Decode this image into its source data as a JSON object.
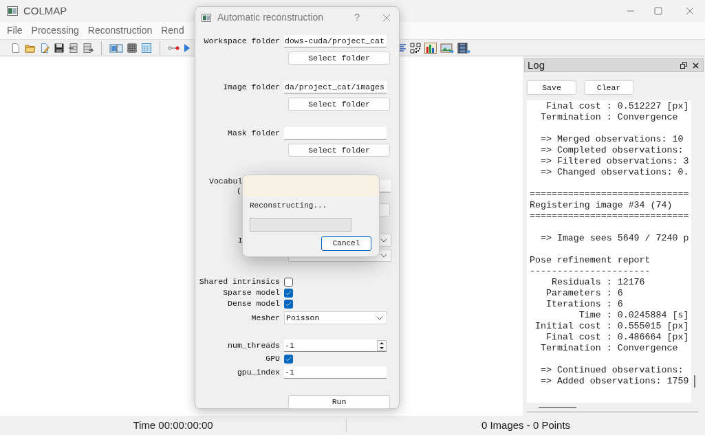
{
  "window": {
    "title": "COLMAP"
  },
  "menu": [
    {
      "label": "File"
    },
    {
      "label": "Processing"
    },
    {
      "label": "Reconstruction"
    },
    {
      "label": "Rend"
    }
  ],
  "log_panel": {
    "title": "Log",
    "buttons": [
      "Save",
      "Clear"
    ],
    "blocks": [
      [
        "   Final cost : 0.512227 [px]",
        "  Termination : Convergence"
      ],
      [
        "  => Merged observations: 10",
        "  => Completed observations:",
        "  => Filtered observations: 3",
        "  => Changed observations: 0."
      ],
      [
        "=============================",
        "Registering image #34 (74)",
        "============================="
      ],
      [
        "  => Image sees 5649 / 7240 p"
      ],
      [
        "Pose refinement report",
        "----------------------",
        "    Residuals : 12176",
        "   Parameters : 6",
        "   Iterations : 6",
        "         Time : 0.0245884 [s]",
        " Initial cost : 0.555015 [px]",
        "   Final cost : 0.486664 [px]",
        "  Termination : Convergence"
      ],
      [
        "  => Continued observations:",
        "  => Added observations: 1759"
      ]
    ]
  },
  "status_bar": {
    "time": "Time 00:00:00:00",
    "counts": "0 Images - 0 Points"
  },
  "dialog": {
    "title": "Automatic reconstruction",
    "help": "?",
    "rows": [
      {
        "kind": "folder",
        "label": "Workspace folder",
        "value": "dows-cuda/project_cat",
        "button": "Select folder"
      },
      {
        "kind": "folder",
        "label": "Image folder",
        "value": "da/project_cat/images",
        "button": "Select folder"
      },
      {
        "kind": "folder",
        "label": "Mask folder",
        "button": "Select folder"
      },
      {
        "kind": "partial_field",
        "label_lines": [
          "Vocabul",
          "("
        ]
      },
      {
        "kind": "partial_button"
      },
      {
        "kind": "partial_select",
        "label": "I"
      },
      {
        "kind": "partial_select"
      },
      {
        "kind": "checkbox",
        "label": "Shared intrinsics",
        "checked": false
      },
      {
        "kind": "checkbox",
        "label": "Sparse model",
        "checked": true
      },
      {
        "kind": "checkbox",
        "label": "Dense model",
        "checked": true
      },
      {
        "kind": "select",
        "label": "Mesher",
        "value": "Poisson"
      },
      {
        "kind": "spin",
        "label": "num_threads",
        "value": "-1"
      },
      {
        "kind": "checkbox",
        "label": "GPU",
        "checked": true
      },
      {
        "kind": "field",
        "label": "gpu_index",
        "value": "-1"
      },
      {
        "kind": "button",
        "button": "Run"
      }
    ]
  },
  "progress_dialog": {
    "message": "Reconstructing...",
    "level": 0,
    "button": "Cancel"
  }
}
